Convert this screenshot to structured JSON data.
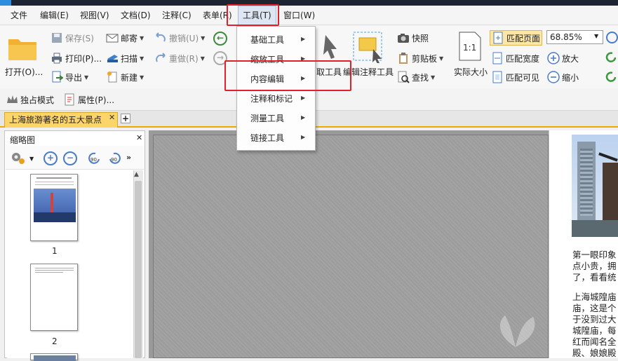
{
  "menubar": {
    "items": [
      "文件",
      "编辑(E)",
      "视图(V)",
      "文档(D)",
      "注释(C)",
      "表单(R)",
      "工具(T)",
      "窗口(W)"
    ]
  },
  "ribbon": {
    "open": "打开(O)...",
    "save": "保存(S)",
    "print": "打印(P)...",
    "export": "导出",
    "mail": "邮寄",
    "scan": "扫描",
    "new": "新建",
    "undo": "撤销(U)",
    "redo": "重做(R)",
    "edit_tool_partial": "取工具",
    "annot_tool": "编辑注释工具",
    "snapshot": "快照",
    "clipboard": "剪贴板",
    "find": "查找",
    "actual_size": "实际大小",
    "fit_page": "匹配页面",
    "fit_width": "匹配宽度",
    "fit_visible": "匹配可见",
    "zoom_value": "68.85%",
    "zoom_in": "放大",
    "zoom_out": "缩小",
    "exclusive_mode": "独占模式",
    "properties": "属性(P)..."
  },
  "doc_tab": {
    "title": "上海旅游著名的五大景点"
  },
  "thumbnail_panel": {
    "title": "缩略图",
    "pages": [
      "1",
      "2"
    ]
  },
  "tools_menu": {
    "items": [
      "基础工具",
      "缩放工具",
      "内容编辑",
      "注释和标记",
      "测量工具",
      "链接工具"
    ]
  },
  "document_text": {
    "lines": [
      "第一眼印象",
      "点小贵，拥",
      "了，看看统",
      "上海城隍庙",
      "庙，这是个",
      "于没到过大",
      "城隍庙，每",
      "红而闻名全",
      "殿、娘娘殿"
    ]
  },
  "colors": {
    "highlight": "#e0202a",
    "tab_active": "#fbd46a"
  }
}
